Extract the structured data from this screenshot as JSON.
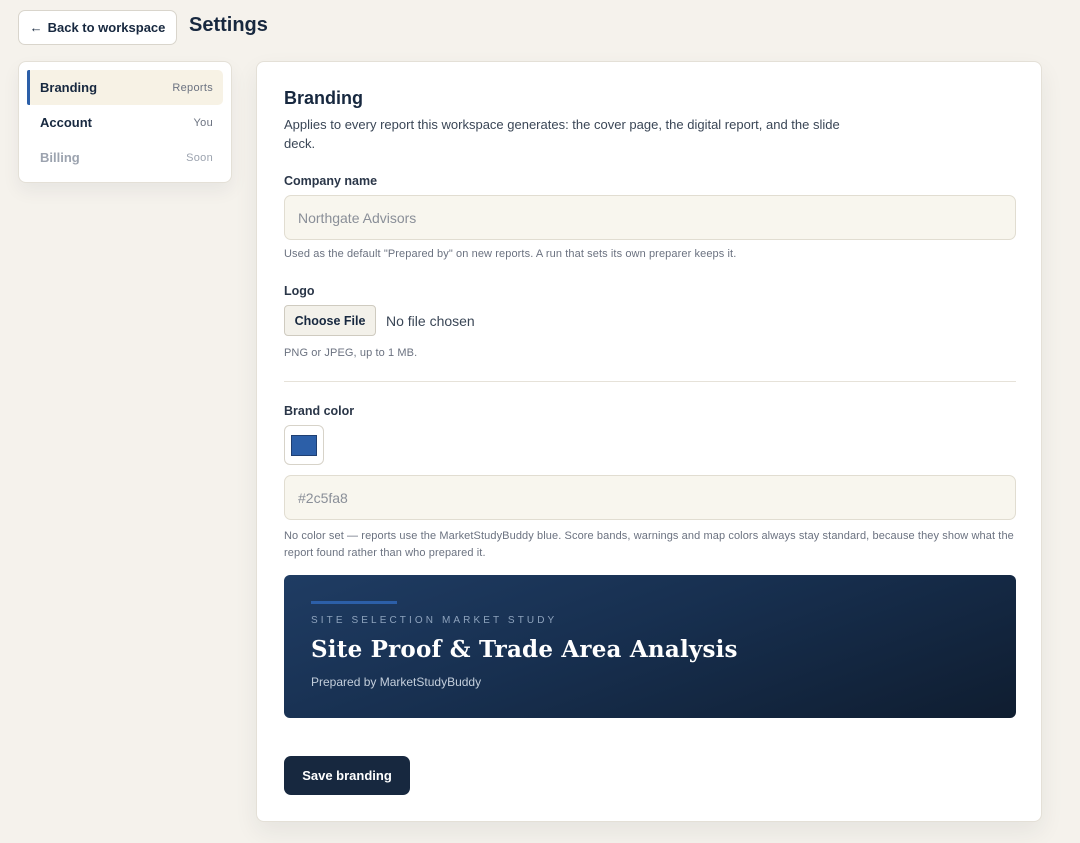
{
  "header": {
    "back_label": "Back to workspace",
    "back_icon": "arrow-left-icon",
    "title": "Settings"
  },
  "sidebar": {
    "items": [
      {
        "label": "Branding",
        "meta": "Reports",
        "active": true,
        "disabled": false
      },
      {
        "label": "Account",
        "meta": "You",
        "active": false,
        "disabled": false
      },
      {
        "label": "Billing",
        "meta": "Soon",
        "active": false,
        "disabled": true
      }
    ]
  },
  "branding": {
    "title": "Branding",
    "description": "Applies to every report this workspace generates: the cover page, the digital report, and the slide deck.",
    "company": {
      "label": "Company name",
      "placeholder": "Northgate Advisors",
      "value": "",
      "help": "Used as the default \"Prepared by\" on new reports. A run that sets its own preparer keeps it."
    },
    "logo": {
      "label": "Logo",
      "button": "Choose File",
      "status": "No file chosen",
      "help": "PNG or JPEG, up to 1 MB."
    },
    "brand_color": {
      "label": "Brand color",
      "swatch_color": "#2c5fa8",
      "placeholder": "#2c5fa8",
      "value": "",
      "help": "No color set — reports use the MarketStudyBuddy blue. Score bands, warnings and map colors always stay standard, because they show what the report found rather than who prepared it."
    },
    "preview": {
      "eyebrow": "SITE SELECTION MARKET STUDY",
      "headline": "Site Proof & Trade Area Analysis",
      "byline": "Prepared by MarketStudyBuddy",
      "accent_color": "#2c5fa8"
    },
    "save_label": "Save branding"
  }
}
